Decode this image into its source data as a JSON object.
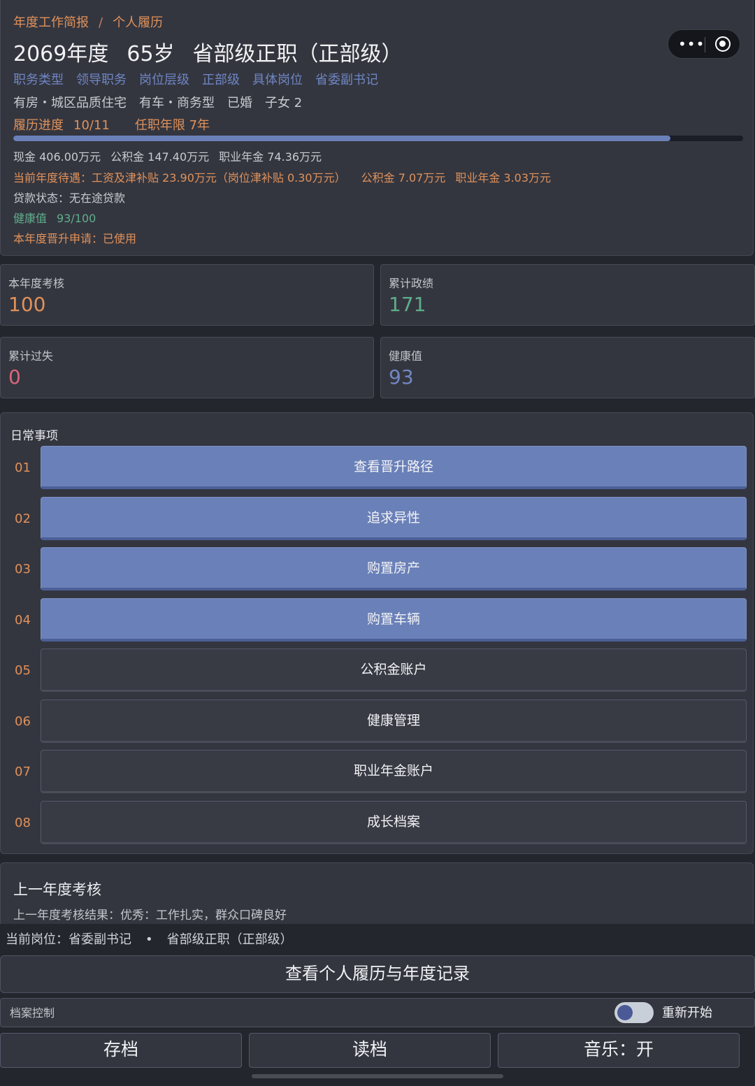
{
  "breadcrumb": [
    "年度工作简报",
    "/",
    "个人履历"
  ],
  "header": {
    "year": "2069年度",
    "age": "65岁",
    "rank": "省部级正职（正部级）"
  },
  "tags": [
    "职务类型",
    "领导职务",
    "岗位层级",
    "正部级",
    "具体岗位",
    "省委副书记"
  ],
  "assets": [
    "有房・城区品质住宅",
    "有车・商务型",
    "已婚",
    "子女 2"
  ],
  "progress": {
    "label": "履历进度",
    "value": "10/11",
    "term": "任职年限 7年",
    "fraction": 0.9
  },
  "finance": {
    "cash": "现金 406.00万元",
    "fund": "公积金 147.40万元",
    "annuity": "职业年金 74.36万元"
  },
  "treatment": {
    "salary": "当前年度待遇：工资及津补贴 23.90万元（岗位津补贴 0.30万元）",
    "fund": "公积金 7.07万元",
    "annuity": "职业年金 3.03万元"
  },
  "loan": "贷款状态：无在途贷款",
  "health": {
    "label": "健康值",
    "value": "93/100"
  },
  "promotion_apply": "本年度晋升申请：已使用",
  "stats": {
    "assessment": {
      "label": "本年度考核",
      "value": "100",
      "color": "#e0915a"
    },
    "merit": {
      "label": "累计政绩",
      "value": "171",
      "color": "#5fae8c"
    },
    "fault": {
      "label": "累计过失",
      "value": "0",
      "color": "#d9667a"
    },
    "health": {
      "label": "健康值",
      "value": "93",
      "color": "#7186c2"
    }
  },
  "daily": {
    "title": "日常事项",
    "items": [
      {
        "num": "01",
        "label": "查看晋升路径",
        "style": "blue"
      },
      {
        "num": "02",
        "label": "追求异性",
        "style": "blue"
      },
      {
        "num": "03",
        "label": "购置房产",
        "style": "blue"
      },
      {
        "num": "04",
        "label": "购置车辆",
        "style": "blue"
      },
      {
        "num": "05",
        "label": "公积金账户",
        "style": "dark"
      },
      {
        "num": "06",
        "label": "健康管理",
        "style": "dark"
      },
      {
        "num": "07",
        "label": "职业年金账户",
        "style": "dark"
      },
      {
        "num": "08",
        "label": "成长档案",
        "style": "dark"
      }
    ]
  },
  "last_year": {
    "title": "上一年度考核",
    "result": "上一年度考核结果：优秀：工作扎实，群众口碑良好"
  },
  "current_position": {
    "post": "当前岗位：省委副书记",
    "dot": "•",
    "rank": "省部级正职（正部级）"
  },
  "record_button": "查看个人履历与年度记录",
  "archive": {
    "label": "档案控制",
    "restart_label": "重新开始",
    "toggle_on": false
  },
  "bottom_buttons": {
    "save": "存档",
    "load": "读档",
    "music": "音乐：开"
  },
  "colors": {
    "accent_orange": "#e0915a",
    "accent_blue": "#6a80b8",
    "accent_green": "#5fae8c"
  }
}
